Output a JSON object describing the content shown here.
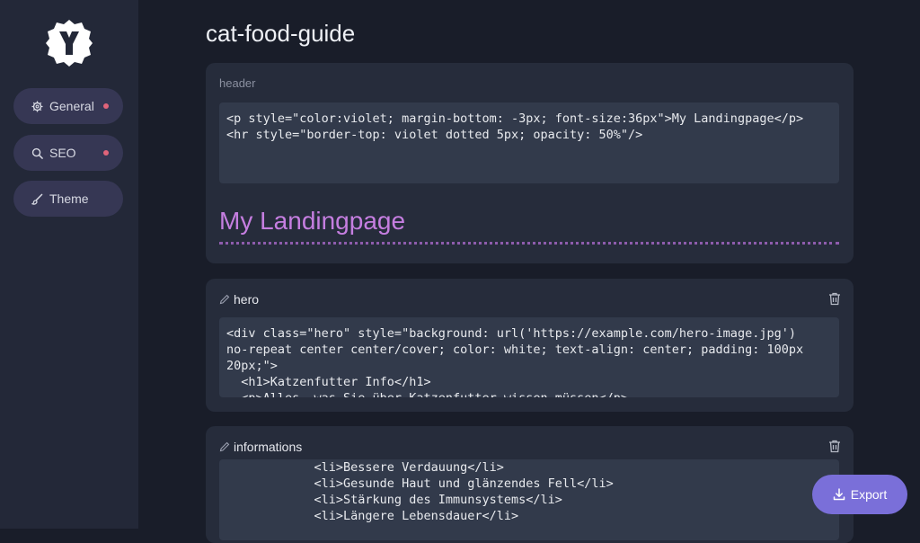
{
  "sidebar": {
    "logo": "Y-badge-logo",
    "items": [
      {
        "label": "General",
        "icon": "gear-icon",
        "has_dot": true
      },
      {
        "label": "SEO",
        "icon": "search-icon",
        "has_dot": true
      },
      {
        "label": "Theme",
        "icon": "brush-icon",
        "has_dot": false
      }
    ]
  },
  "page": {
    "title": "cat-food-guide"
  },
  "sections": {
    "header": {
      "label": "header",
      "code": "<p style=\"color:violet; margin-bottom: -3px; font-size:36px\">My Landingpage</p>\n<hr style=\"border-top: violet dotted 5px; opacity: 50%\"/>",
      "preview_title": "My Landingpage"
    },
    "hero": {
      "label": "hero",
      "code": "<div class=\"hero\" style=\"background: url('https://example.com/hero-image.jpg')\nno-repeat center center/cover; color: white; text-align: center; padding: 100px\n20px;\">\n  <h1>Katzenfutter Info</h1>\n  <p>Alles, was Sie über Katzenfutter wissen müssen</p>"
    },
    "informations": {
      "label": "informations",
      "code": "            <li>Bessere Verdauung</li>\n            <li>Gesunde Haut und glänzendes Fell</li>\n            <li>Stärkung des Immunsystems</li>\n            <li>Längere Lebensdauer</li>"
    }
  },
  "export": {
    "label": "Export",
    "icon": "download-icon"
  },
  "colors": {
    "accent": "#7a6fd9",
    "dot": "#e0647a",
    "preview_violet": "#c57ee0",
    "sidebar_bg": "#232838",
    "page_bg": "#191d29",
    "card_bg": "#262c3b"
  }
}
